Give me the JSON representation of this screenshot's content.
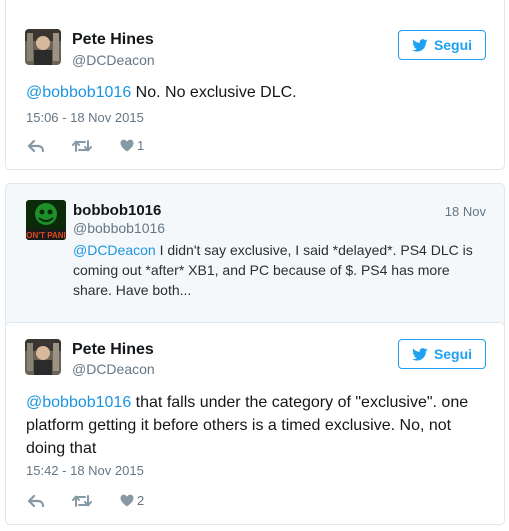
{
  "tweet1": {
    "name": "Pete Hines",
    "handle": "@DCDeacon",
    "follow_label": "Segui",
    "mention": "@bobbob1016",
    "text": " No. No exclusive DLC.",
    "timestamp": "15:06 - 18 Nov 2015",
    "like_count": "1"
  },
  "reply": {
    "name": "bobbob1016",
    "handle": "@bobbob1016",
    "date": "18 Nov",
    "mention": "@DCDeacon",
    "text": " I didn't say exclusive, I said *delayed*. PS4 DLC is coming out *after* XB1, and PC because of $. PS4 has more share. Have both...",
    "avatar_text": "ON'T PANI"
  },
  "tweet2": {
    "name": "Pete Hines",
    "handle": "@DCDeacon",
    "follow_label": "Segui",
    "mention": "@bobbob1016",
    "text": " that falls under the category of \"exclusive\". one platform getting it before others is a timed exclusive. No, not doing that",
    "timestamp": "15:42 - 18 Nov 2015",
    "like_count": "2"
  },
  "colors": {
    "link": "#1b95e0",
    "follow": "#1da1f2",
    "muted": "#657786",
    "icon": "#8899a6"
  },
  "icons": {
    "follow": "bird-icon",
    "reply": "reply-icon",
    "retweet": "retweet-icon",
    "like": "heart-icon"
  }
}
